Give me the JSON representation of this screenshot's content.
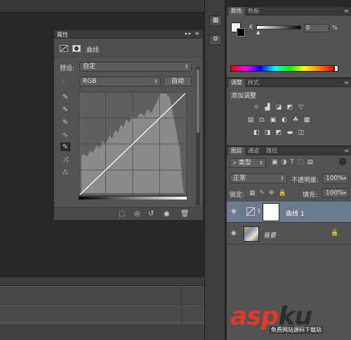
{
  "properties_panel": {
    "title": "属性",
    "header_label": "曲线",
    "preset_label": "预设:",
    "preset_value": "自定",
    "channel_value": "RGB",
    "auto_button": "自动"
  },
  "color_panel": {
    "tabs": [
      "颜色",
      "色板"
    ],
    "k_label": "K",
    "k_value": "0",
    "k_unit": "%"
  },
  "adjustments_panel": {
    "tabs": [
      "调整",
      "样式"
    ],
    "add_label": "添加调整"
  },
  "layers_panel": {
    "tabs": [
      "图层",
      "通道",
      "路径"
    ],
    "filter_label": "类型",
    "blend_mode": "正常",
    "opacity_label": "不透明度:",
    "opacity_value": "100%",
    "lock_label": "锁定:",
    "fill_label": "填充:",
    "fill_value": "100%",
    "layers": [
      {
        "name": "曲线 1"
      },
      {
        "name": "背景"
      }
    ]
  },
  "watermark": {
    "text_a": "asp",
    "text_b": "ku",
    "sub": "免费网站源码下载站"
  }
}
